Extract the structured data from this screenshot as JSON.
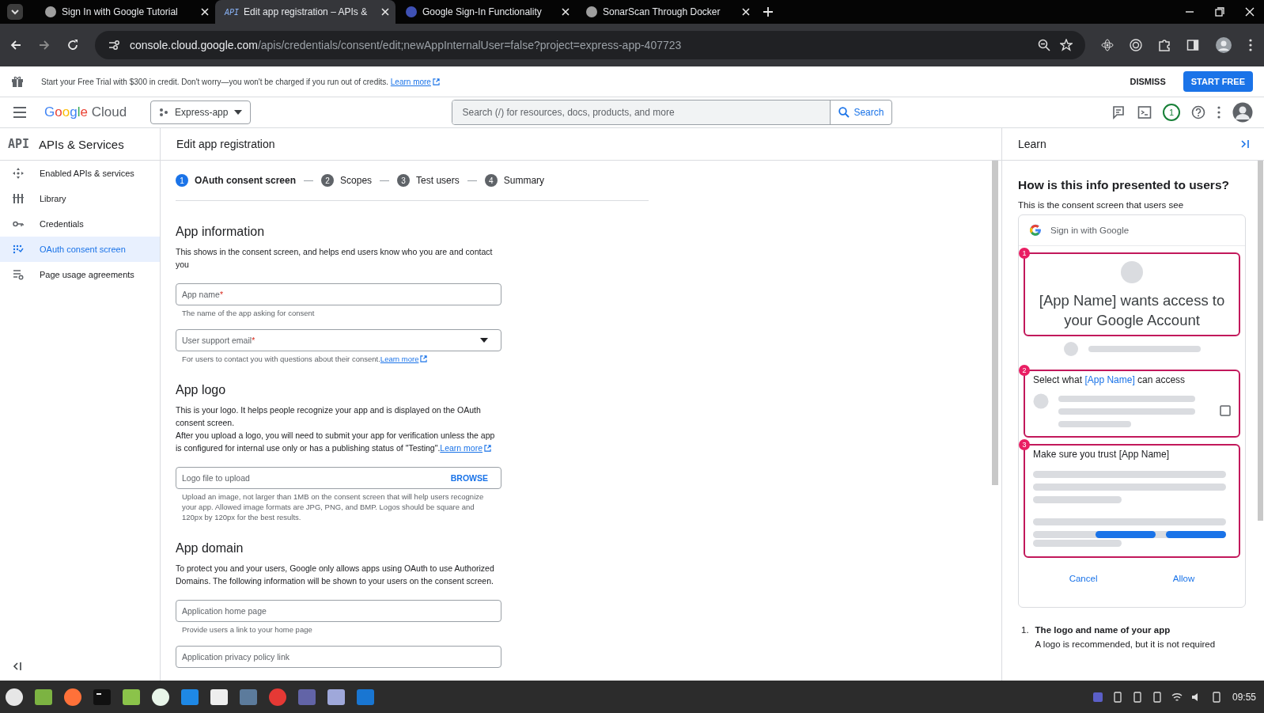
{
  "browser": {
    "tabs": [
      {
        "title": "Sign In with Google Tutorial",
        "selected": false
      },
      {
        "title": "Edit app registration – APIs &",
        "favicon_text": "API",
        "selected": true
      },
      {
        "title": "Google Sign-In Functionality",
        "selected": false
      },
      {
        "title": "SonarScan Through Docker",
        "selected": false
      }
    ],
    "url": {
      "host": "console.cloud.google.com",
      "path": "/apis/credentials/consent/edit;newAppInternalUser=false?project=express-app-407723"
    }
  },
  "banner": {
    "text": "Start your Free Trial with $300 in credit. Don't worry—you won't be charged if you run out of credits.",
    "link": "Learn more",
    "dismiss": "DISMISS",
    "start": "START FREE"
  },
  "header": {
    "logo": "Google Cloud",
    "project": "Express-app",
    "search_placeholder": "Search (/) for resources, docs, products, and more",
    "search_button": "Search",
    "notifications": "1"
  },
  "sidebar": {
    "logo": "API",
    "title": "APIs & Services",
    "items": [
      {
        "label": "Enabled APIs & services",
        "selected": false
      },
      {
        "label": "Library",
        "selected": false
      },
      {
        "label": "Credentials",
        "selected": false
      },
      {
        "label": "OAuth consent screen",
        "selected": true
      },
      {
        "label": "Page usage agreements",
        "selected": false
      }
    ]
  },
  "main": {
    "title": "Edit app registration",
    "steps": [
      {
        "number": "1",
        "label": "OAuth consent screen",
        "selected": true
      },
      {
        "number": "2",
        "label": "Scopes",
        "selected": false
      },
      {
        "number": "3",
        "label": "Test users",
        "selected": false
      },
      {
        "number": "4",
        "label": "Summary",
        "selected": false
      }
    ],
    "sections": [
      {
        "heading": "App information",
        "paragraphs": [
          {
            "text": "This shows in the consent screen, and helps end users know who you are and contact you"
          }
        ],
        "fields": [
          {
            "kind": "text",
            "label": "App name",
            "mark": "*",
            "hint": "The name of the app asking for consent"
          },
          {
            "kind": "select",
            "label": "User support email",
            "mark": "*",
            "hint": "For users to contact you with questions about their consent.",
            "hint_link": "Learn more"
          }
        ]
      },
      {
        "heading": "App logo",
        "paragraphs": [
          {
            "text": "This is your logo. It helps people recognize your app and is displayed on the OAuth consent screen."
          },
          {
            "text": "After you upload a logo, you will need to submit your app for verification unless the app is configured for internal use only or has a publishing status of \"Testing\".",
            "link": "Learn more"
          }
        ],
        "fields": [
          {
            "kind": "file",
            "label": "Logo file to upload",
            "action": "BROWSE",
            "hint": "Upload an image, not larger than 1MB on the consent screen that will help users recognize your app. Allowed image formats are JPG, PNG, and BMP. Logos should be square and 120px by 120px for the best results."
          }
        ]
      },
      {
        "heading": "App domain",
        "paragraphs": [
          {
            "text": "To protect you and your users, Google only allows apps using OAuth to use Authorized Domains. The following information will be shown to your users on the consent screen."
          }
        ],
        "fields": [
          {
            "kind": "text",
            "label": "Application home page",
            "hint": "Provide users a link to your home page"
          },
          {
            "kind": "text",
            "label": "Application privacy policy link"
          }
        ]
      }
    ]
  },
  "learn": {
    "title": "Learn",
    "heading": "How is this info presented to users?",
    "subheading": "This is the consent screen that users see",
    "preview": {
      "signin": "Sign in with Google",
      "box1": {
        "badge": "1",
        "text": "[App Name] wants access to your Google Account"
      },
      "box2": {
        "badge": "2",
        "before": "Select what ",
        "highlight": "[App Name]",
        "after": " can access"
      },
      "box3": {
        "badge": "3",
        "text": "Make sure you trust [App Name]"
      },
      "cancel": "Cancel",
      "allow": "Allow"
    },
    "notes": [
      {
        "number": "1.",
        "title": "The logo and name of your app",
        "text": "A logo is recommended, but it is not required"
      }
    ]
  },
  "taskbar": {
    "clock": "09:55"
  }
}
